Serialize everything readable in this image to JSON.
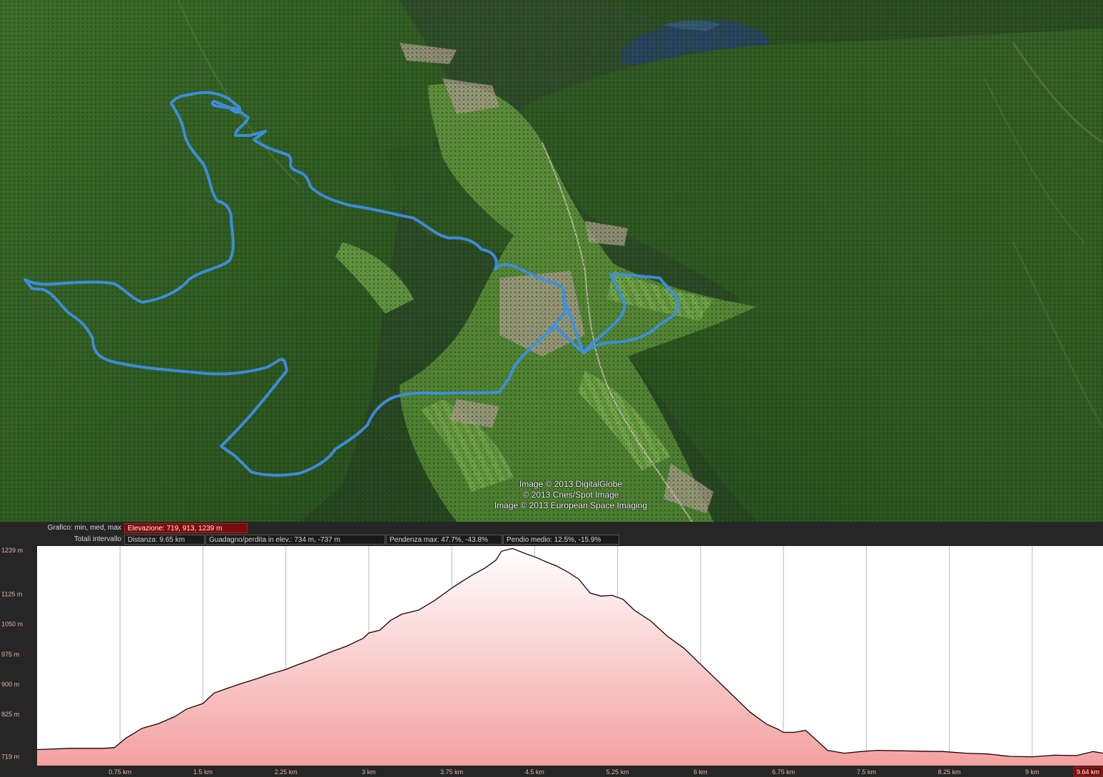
{
  "map": {
    "attributions": [
      "Image © 2013 DigitalGlobe",
      "© 2013 Cnes/Spot Image",
      "Image © 2013 European Space Imaging"
    ],
    "track_color": "#3d8fe6"
  },
  "stats": {
    "chart_label": "Grafico: min, med, max",
    "elevation": "Elevazione: 719, 913, 1239 m",
    "totals_label": "Totali intervallo",
    "distance": "Distanza: 9.65 km",
    "gain_loss": "Guadagno/perdita in elev.: 734 m, -737 m",
    "max_slope": "Pendenza max: 47.7%, -43.8%",
    "avg_slope": "Pendio medio: 12.5%, -15.9%"
  },
  "chart_data": {
    "type": "area",
    "xlabel": "",
    "ylabel": "",
    "ylim": [
      697,
      1245
    ],
    "xlim": [
      0,
      9.64
    ],
    "y_ticks": [
      {
        "value": 719,
        "label": "719 m"
      },
      {
        "value": 825,
        "label": "825 m"
      },
      {
        "value": 900,
        "label": "900 m"
      },
      {
        "value": 975,
        "label": "975 m"
      },
      {
        "value": 1050,
        "label": "1050 m"
      },
      {
        "value": 1125,
        "label": "1125 m"
      },
      {
        "value": 1239,
        "label": "1239 m"
      }
    ],
    "x_ticks": [
      {
        "value": 0.75,
        "label": "0.75 km"
      },
      {
        "value": 1.5,
        "label": "1.5 km"
      },
      {
        "value": 2.25,
        "label": "2.25 km"
      },
      {
        "value": 3,
        "label": "3 km"
      },
      {
        "value": 3.75,
        "label": "3.75 km"
      },
      {
        "value": 4.5,
        "label": "4.5 km"
      },
      {
        "value": 5.25,
        "label": "5.25 km"
      },
      {
        "value": 6,
        "label": "6 km"
      },
      {
        "value": 6.75,
        "label": "6.75 km"
      },
      {
        "value": 7.5,
        "label": "7.5 km"
      },
      {
        "value": 8.25,
        "label": "8.25 km"
      },
      {
        "value": 9,
        "label": "9 km"
      }
    ],
    "end_label": "9.64 km",
    "fill_top": "#ffffff",
    "fill_bottom": "#f4a0a0",
    "line_color": "#1a0000",
    "x": [
      0,
      0.3,
      0.6,
      0.7,
      0.8,
      0.95,
      1.1,
      1.25,
      1.35,
      1.5,
      1.6,
      1.7,
      1.85,
      2.0,
      2.1,
      2.25,
      2.35,
      2.5,
      2.65,
      2.8,
      2.95,
      3.0,
      3.1,
      3.2,
      3.3,
      3.45,
      3.6,
      3.75,
      3.85,
      3.95,
      4.05,
      4.15,
      4.2,
      4.3,
      4.4,
      4.5,
      4.6,
      4.7,
      4.8,
      4.9,
      5.0,
      5.1,
      5.2,
      5.3,
      5.4,
      5.55,
      5.7,
      5.85,
      6.0,
      6.15,
      6.3,
      6.45,
      6.6,
      6.7,
      6.75,
      6.85,
      6.95,
      7.05,
      7.15,
      7.3,
      7.45,
      7.6,
      7.8,
      8.0,
      8.2,
      8.4,
      8.6,
      8.8,
      9.0,
      9.2,
      9.4,
      9.55,
      9.64
    ],
    "y": [
      737,
      740,
      740,
      742,
      765,
      790,
      802,
      820,
      838,
      852,
      878,
      888,
      902,
      915,
      925,
      937,
      948,
      963,
      980,
      995,
      1015,
      1028,
      1035,
      1060,
      1075,
      1085,
      1110,
      1140,
      1158,
      1175,
      1190,
      1210,
      1232,
      1239,
      1228,
      1218,
      1206,
      1195,
      1180,
      1162,
      1128,
      1120,
      1122,
      1112,
      1085,
      1058,
      1020,
      990,
      950,
      910,
      870,
      830,
      800,
      788,
      780,
      780,
      785,
      760,
      735,
      728,
      732,
      735,
      734,
      733,
      732,
      728,
      726,
      720,
      719,
      723,
      722,
      732,
      728
    ]
  }
}
